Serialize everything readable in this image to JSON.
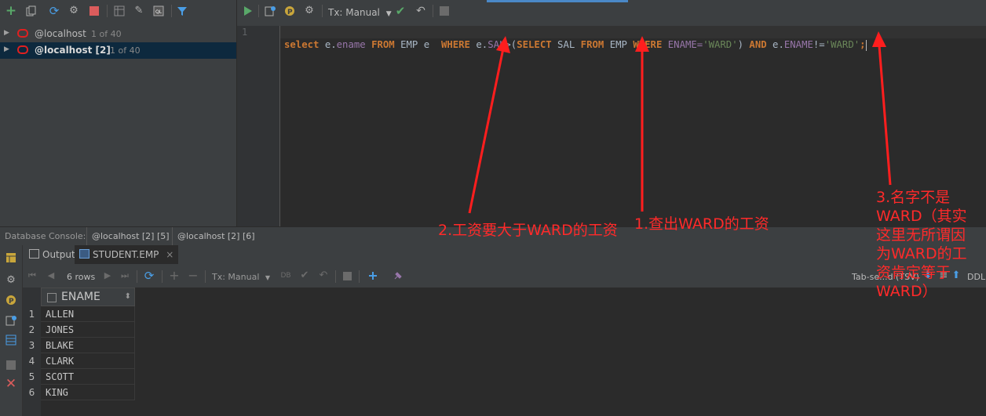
{
  "left_panel": {
    "items": [
      {
        "name": "@localhost",
        "count": "1 of 40"
      },
      {
        "name": "@localhost [2]",
        "count": "1 of 40"
      }
    ]
  },
  "editor": {
    "tx_label": "Tx: Manual",
    "line_number": "1",
    "sql": {
      "t1": "select",
      "t2": " e.",
      "t3": "ename",
      "t4": " FROM",
      "t5": " EMP e  ",
      "t6": "WHERE",
      "t7": " e.",
      "t8": "SAL",
      "t9": ">(",
      "t10": "SELECT",
      "t11": " SAL ",
      "t12": "FROM",
      "t13": " EMP ",
      "t14": "WHERE",
      "t15": " ENAME=",
      "t16": "'WARD'",
      "t17": ") ",
      "t18": "AND",
      "t19": " e.",
      "t20": "ENAME",
      "t21": "!=",
      "t22": "'WARD'",
      "t23": ";"
    }
  },
  "console_tabs": {
    "label": "Database Console:",
    "tabs": [
      "@localhost [2] [5]",
      "@localhost [2] [6]"
    ]
  },
  "result_tabs": {
    "output": "Output",
    "student": "STUDENT.EMP",
    "close": "×"
  },
  "result_toolbar": {
    "rows": "6 rows",
    "tx_label": "Tx: Manual",
    "format": "Tab-se...d (TSV)",
    "ddl": "DDL"
  },
  "table": {
    "column": "ENAME",
    "sort_icon": "⬍",
    "rows": [
      {
        "n": "1",
        "v": "ALLEN"
      },
      {
        "n": "2",
        "v": "JONES"
      },
      {
        "n": "3",
        "v": "BLAKE"
      },
      {
        "n": "4",
        "v": "CLARK"
      },
      {
        "n": "5",
        "v": "SCOTT"
      },
      {
        "n": "6",
        "v": "KING"
      }
    ]
  },
  "annotations": {
    "a1": "1.查出WARD的工资",
    "a2": "2.工资要大于WARD的工资",
    "a3": [
      "3.名字不是",
      "WARD（其实",
      "这里无所谓因",
      "为WARD的工",
      "资肯定等于",
      "WARD）"
    ]
  },
  "colors": {
    "keyword": "#cc7832",
    "string": "#6a8759",
    "field": "#9876aa",
    "annotation": "#ff2020"
  }
}
